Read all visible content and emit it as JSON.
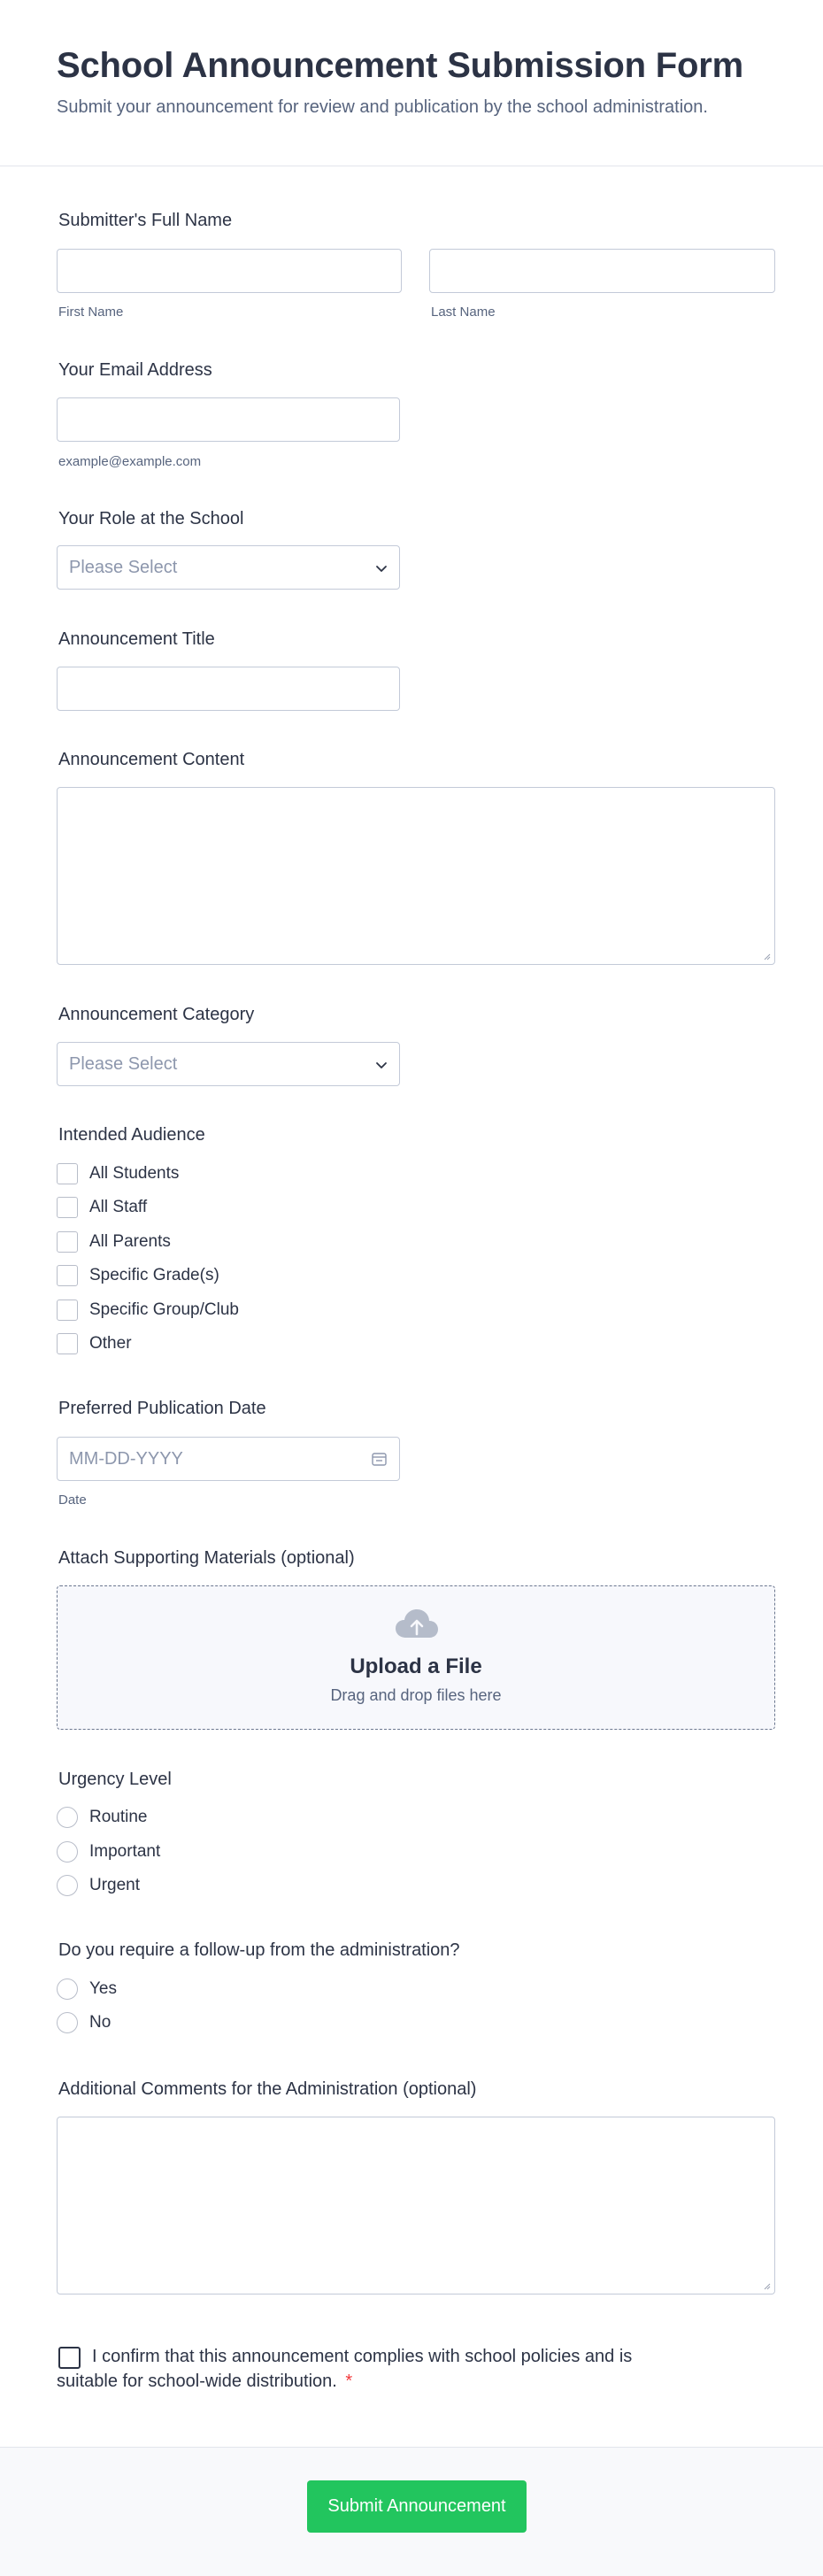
{
  "header": {
    "title": "School Announcement Submission Form",
    "subtitle": "Submit your announcement for review and publication by the school administration."
  },
  "fields": {
    "full_name": {
      "label": "Submitter's Full Name",
      "first_sublabel": "First Name",
      "last_sublabel": "Last Name",
      "first_value": "",
      "last_value": ""
    },
    "email": {
      "label": "Your Email Address",
      "sublabel": "example@example.com",
      "value": ""
    },
    "role": {
      "label": "Your Role at the School",
      "placeholder": "Please Select"
    },
    "title": {
      "label": "Announcement Title",
      "value": ""
    },
    "content": {
      "label": "Announcement Content",
      "value": ""
    },
    "category": {
      "label": "Announcement Category",
      "placeholder": "Please Select"
    },
    "audience": {
      "label": "Intended Audience",
      "options": [
        "All Students",
        "All Staff",
        "All Parents",
        "Specific Grade(s)",
        "Specific Group/Club",
        "Other"
      ]
    },
    "date": {
      "label": "Preferred Publication Date",
      "placeholder": "MM-DD-YYYY",
      "sublabel": "Date",
      "icon": "calendar-icon"
    },
    "attach": {
      "label": "Attach Supporting Materials (optional)",
      "upload_title": "Upload a File",
      "upload_hint": "Drag and drop files here",
      "icon": "cloud-upload-icon"
    },
    "urgency": {
      "label": "Urgency Level",
      "options": [
        "Routine",
        "Important",
        "Urgent"
      ]
    },
    "followup": {
      "label": "Do you require a follow-up from the administration?",
      "options": [
        "Yes",
        "No"
      ]
    },
    "comments": {
      "label": "Additional Comments for the Administration (optional)",
      "value": ""
    },
    "confirm": {
      "line1": "I confirm that this announcement complies with school policies and is",
      "line2": "suitable for school-wide distribution.",
      "required_mark": "*"
    }
  },
  "submit": {
    "label": "Submit Announcement"
  },
  "colors": {
    "accent": "#22c55e",
    "text": "#2c3345",
    "muted": "#57647e",
    "border": "#c3cad8",
    "required": "#f23a3c"
  }
}
